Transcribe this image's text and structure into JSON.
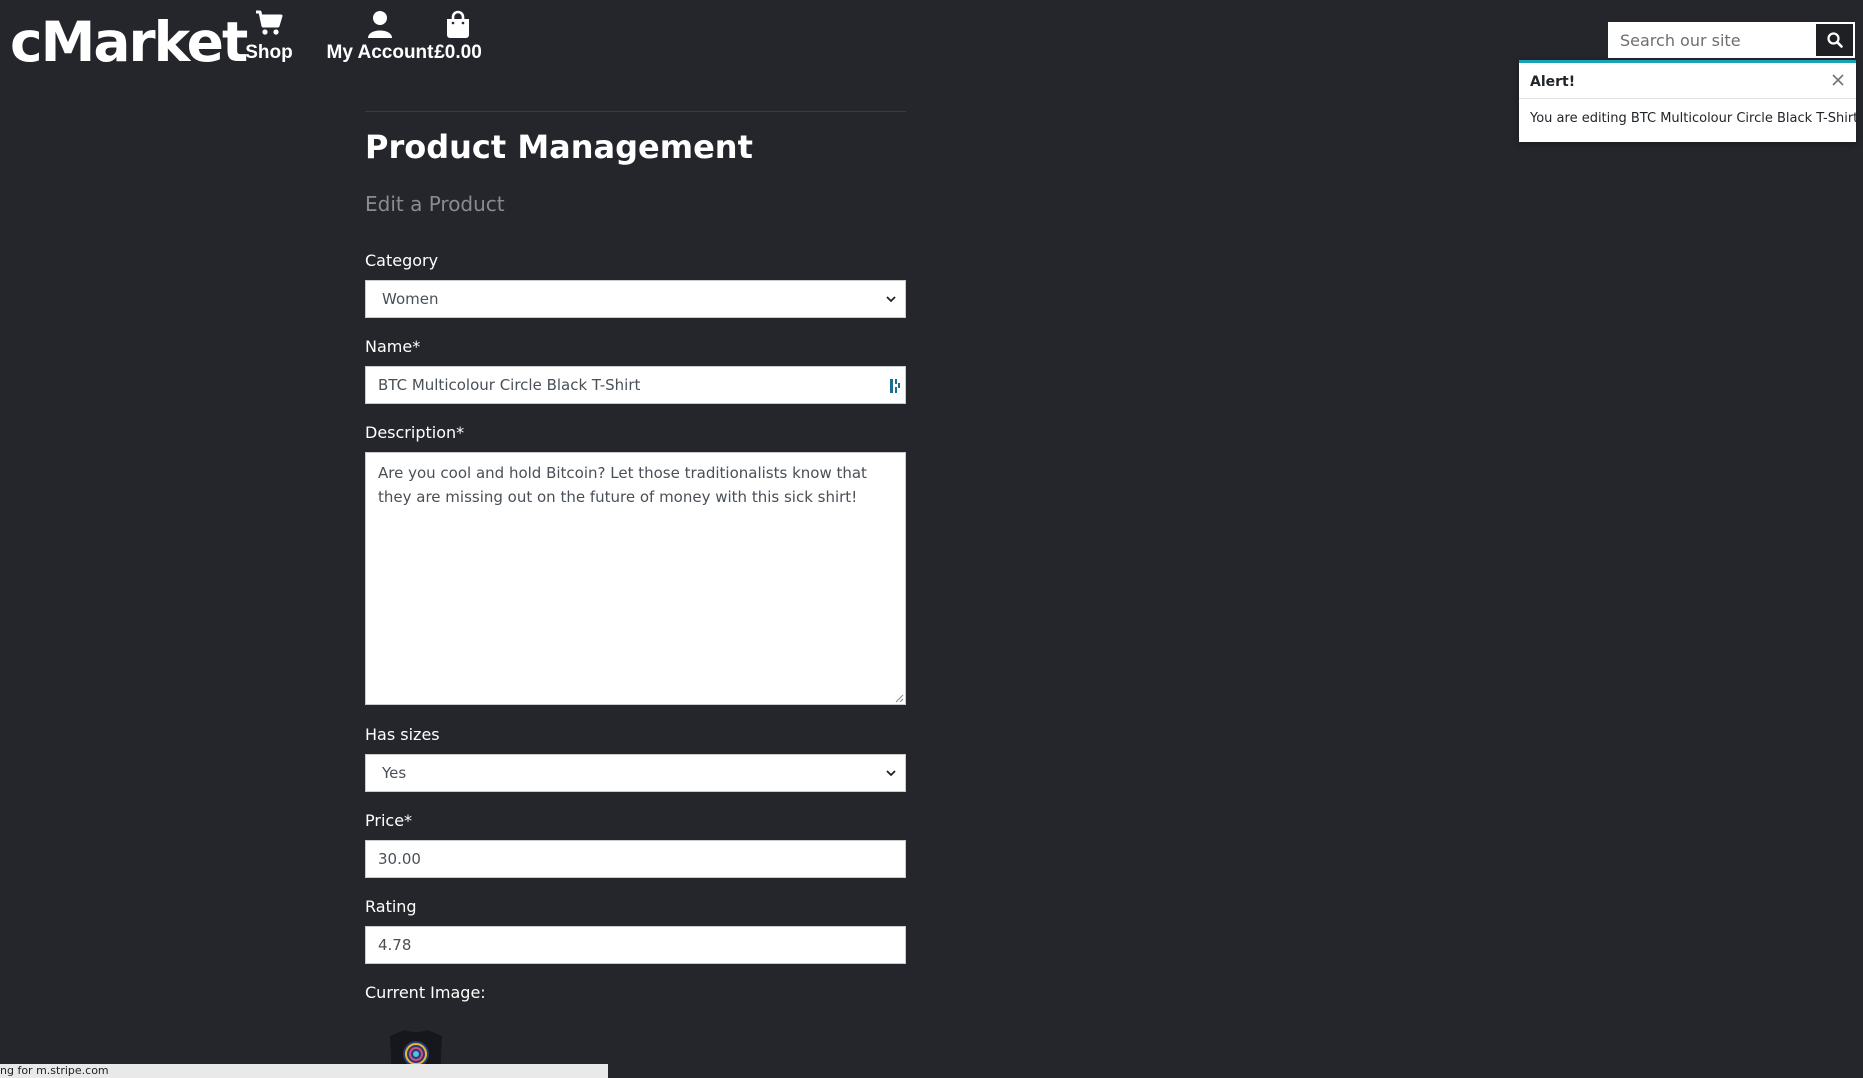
{
  "brand": {
    "logo": "cMarket"
  },
  "nav": {
    "shop": "Shop",
    "account": "My Account",
    "bag_total": "£0.00"
  },
  "search": {
    "placeholder": "Search our site"
  },
  "toast": {
    "title": "Alert!",
    "message": "You are editing BTC Multicolour Circle Black T-Shirt"
  },
  "page": {
    "title": "Product Management",
    "subtitle": "Edit a Product"
  },
  "form": {
    "category": {
      "label": "Category",
      "value": "Women"
    },
    "name": {
      "label": "Name*",
      "value": "BTC Multicolour Circle Black T-Shirt"
    },
    "description": {
      "label": "Description*",
      "value": "Are you cool and hold Bitcoin? Let those traditionalists know that they are missing out on the future of money with this sick shirt!"
    },
    "has_sizes": {
      "label": "Has sizes",
      "value": "Yes"
    },
    "price": {
      "label": "Price*",
      "value": "30.00"
    },
    "rating": {
      "label": "Rating",
      "value": "4.78"
    },
    "current_image": {
      "label": "Current Image:"
    }
  },
  "status_bar": {
    "text": "ng for m.stripe.com"
  },
  "colors": {
    "background": "#25262b",
    "toast_accent": "#17a2b8"
  }
}
